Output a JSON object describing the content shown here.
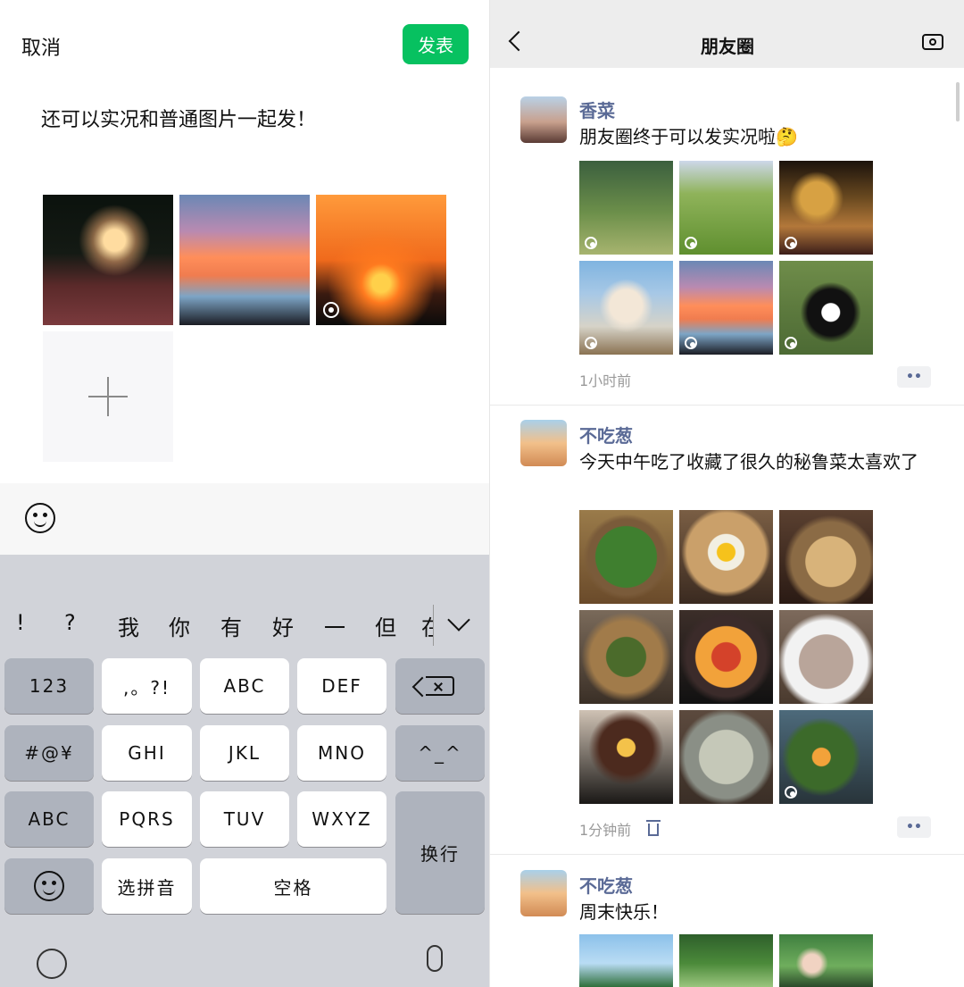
{
  "composer": {
    "cancel_label": "取消",
    "post_label": "发表",
    "text": "还可以实况和普通图片一起发！"
  },
  "keyboard": {
    "candidates": [
      "!",
      "?",
      "我",
      "你",
      "有",
      "好",
      "一",
      "但",
      "在"
    ],
    "keys": {
      "k123": "123",
      "punct": ",。?!",
      "abc1": "ABC",
      "def": "DEF",
      "delete_icon": "backspace-icon",
      "symbols": "#@¥",
      "ghi": "GHI",
      "jkl": "JKL",
      "mno": "MNO",
      "emoticon": "^_^",
      "abc2": "ABC",
      "pqrs": "PQRS",
      "tuv": "TUV",
      "wxyz": "WXYZ",
      "newline": "换行",
      "pinyin": "选拼音",
      "space": "空格"
    }
  },
  "feed": {
    "title": "朋友圈",
    "posts": [
      {
        "name": "香菜",
        "text": "朋友圈终于可以发实况啦🤔",
        "time": "1小时前",
        "more": "••"
      },
      {
        "name": "不吃葱",
        "text": "今天中午吃了收藏了很久的秘鲁菜太喜欢了",
        "time": "1分钟前",
        "more": "••"
      },
      {
        "name": "不吃葱",
        "text": "周末快乐！"
      }
    ]
  },
  "colors": {
    "post_button": "#07c160",
    "name": "#5a6a96",
    "time": "#9a9a9a"
  }
}
